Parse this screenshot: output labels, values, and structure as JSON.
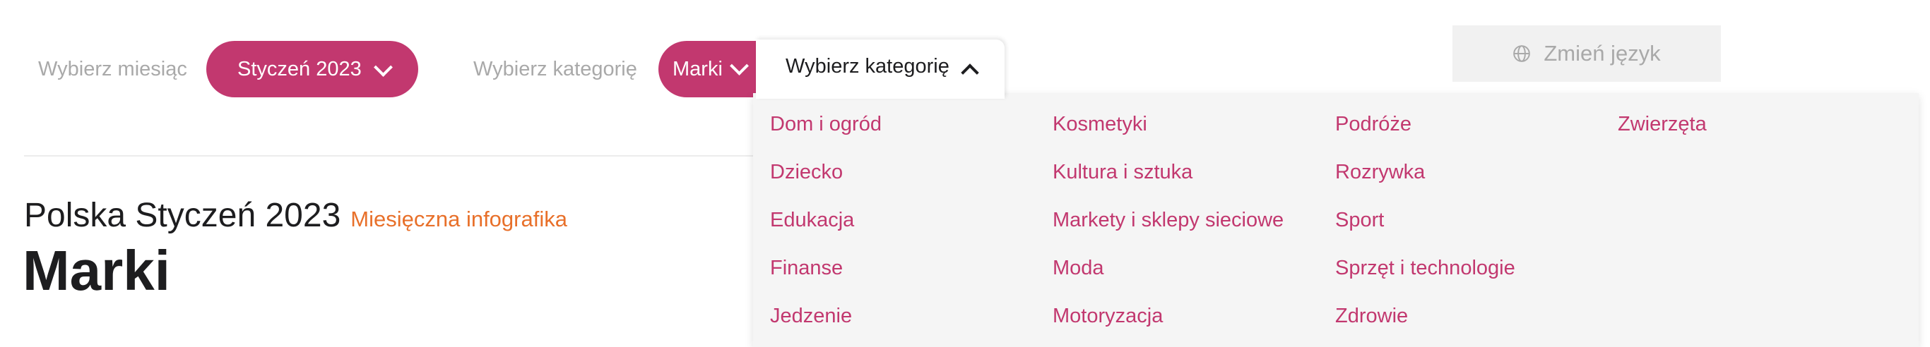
{
  "filters": {
    "month_label": "Wybierz miesiąc",
    "month_value": "Styczeń 2023",
    "category_label": "Wybierz kategorię",
    "category_value": "Marki"
  },
  "category_dropdown": {
    "header": "Wybierz kategorię",
    "columns": [
      [
        "Dom i ogród",
        "Dziecko",
        "Edukacja",
        "Finanse",
        "Jedzenie"
      ],
      [
        "Kosmetyki",
        "Kultura i sztuka",
        "Markety i sklepy sieciowe",
        "Moda",
        "Motoryzacja"
      ],
      [
        "Podróże",
        "Rozrywka",
        "Sport",
        "Sprzęt i technologie",
        "Zdrowie"
      ],
      [
        "Zwierzęta"
      ]
    ]
  },
  "language_button": {
    "label": "Zmień język",
    "icon": "globe-icon"
  },
  "heading": {
    "subtitle": "Polska Styczeń 2023",
    "accent": "Miesięczna infografika",
    "title": "Marki"
  },
  "colors": {
    "accent": "#c2386f",
    "orange": "#e8702a",
    "muted": "#a9a9a9"
  }
}
